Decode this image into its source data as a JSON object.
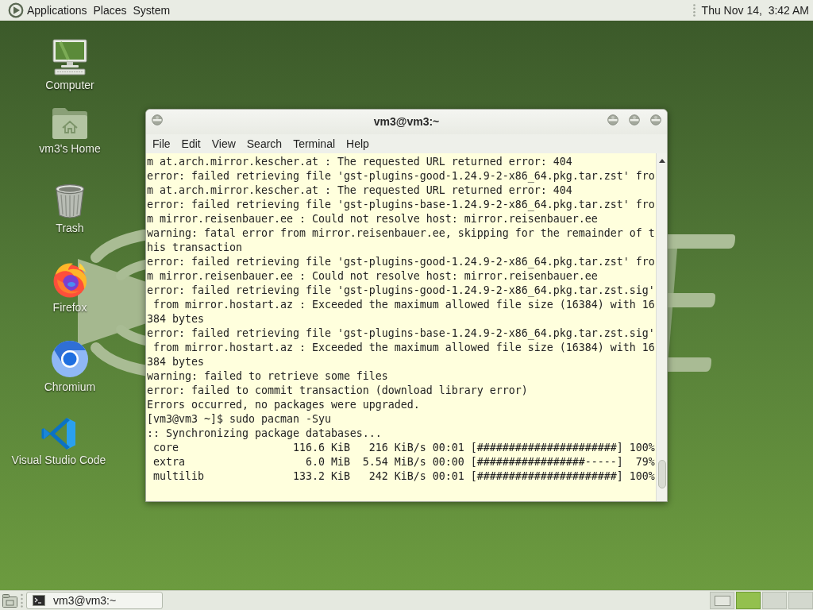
{
  "top_panel": {
    "menus": [
      "Applications",
      "Places",
      "System"
    ],
    "clock": "Thu Nov 14,  3:42 AM"
  },
  "desktop_icons": [
    {
      "label": "Computer",
      "kind": "computer"
    },
    {
      "label": "vm3's Home",
      "kind": "home"
    },
    {
      "label": "Trash",
      "kind": "trash"
    },
    {
      "label": "Firefox",
      "kind": "firefox"
    },
    {
      "label": "Chromium",
      "kind": "chromium"
    },
    {
      "label": "Visual Studio Code",
      "kind": "vscode"
    }
  ],
  "terminal_window": {
    "title": "vm3@vm3:~",
    "menu": [
      "File",
      "Edit",
      "View",
      "Search",
      "Terminal",
      "Help"
    ],
    "lines": [
      "m at.arch.mirror.kescher.at : The requested URL returned error: 404",
      "error: failed retrieving file 'gst-plugins-good-1.24.9-2-x86_64.pkg.tar.zst' fro",
      "m at.arch.mirror.kescher.at : The requested URL returned error: 404",
      "error: failed retrieving file 'gst-plugins-base-1.24.9-2-x86_64.pkg.tar.zst' fro",
      "m mirror.reisenbauer.ee : Could not resolve host: mirror.reisenbauer.ee",
      "warning: fatal error from mirror.reisenbauer.ee, skipping for the remainder of t",
      "his transaction",
      "error: failed retrieving file 'gst-plugins-good-1.24.9-2-x86_64.pkg.tar.zst' fro",
      "m mirror.reisenbauer.ee : Could not resolve host: mirror.reisenbauer.ee",
      "error: failed retrieving file 'gst-plugins-good-1.24.9-2-x86_64.pkg.tar.zst.sig'",
      " from mirror.hostart.az : Exceeded the maximum allowed file size (16384) with 16",
      "384 bytes",
      "error: failed retrieving file 'gst-plugins-base-1.24.9-2-x86_64.pkg.tar.zst.sig'",
      " from mirror.hostart.az : Exceeded the maximum allowed file size (16384) with 16",
      "384 bytes",
      "warning: failed to retrieve some files",
      "error: failed to commit transaction (download library error)",
      "Errors occurred, no packages were upgraded.",
      "[vm3@vm3 ~]$ sudo pacman -Syu",
      ":: Synchronizing package databases...",
      " core                  116.6 KiB   216 KiB/s 00:01 [######################] 100%",
      " extra                   6.0 MiB  5.54 MiB/s 00:00 [#################-----]  79%",
      " multilib              133.2 KiB   242 KiB/s 00:01 [######################] 100%"
    ]
  },
  "bottom_panel": {
    "tasks": [
      {
        "label": "vm3@vm3:~"
      }
    ],
    "workspaces": [
      {
        "selected": false,
        "has_window": true
      },
      {
        "selected": true,
        "has_window": false
      },
      {
        "selected": false,
        "has_window": false
      },
      {
        "selected": false,
        "has_window": false
      }
    ]
  }
}
